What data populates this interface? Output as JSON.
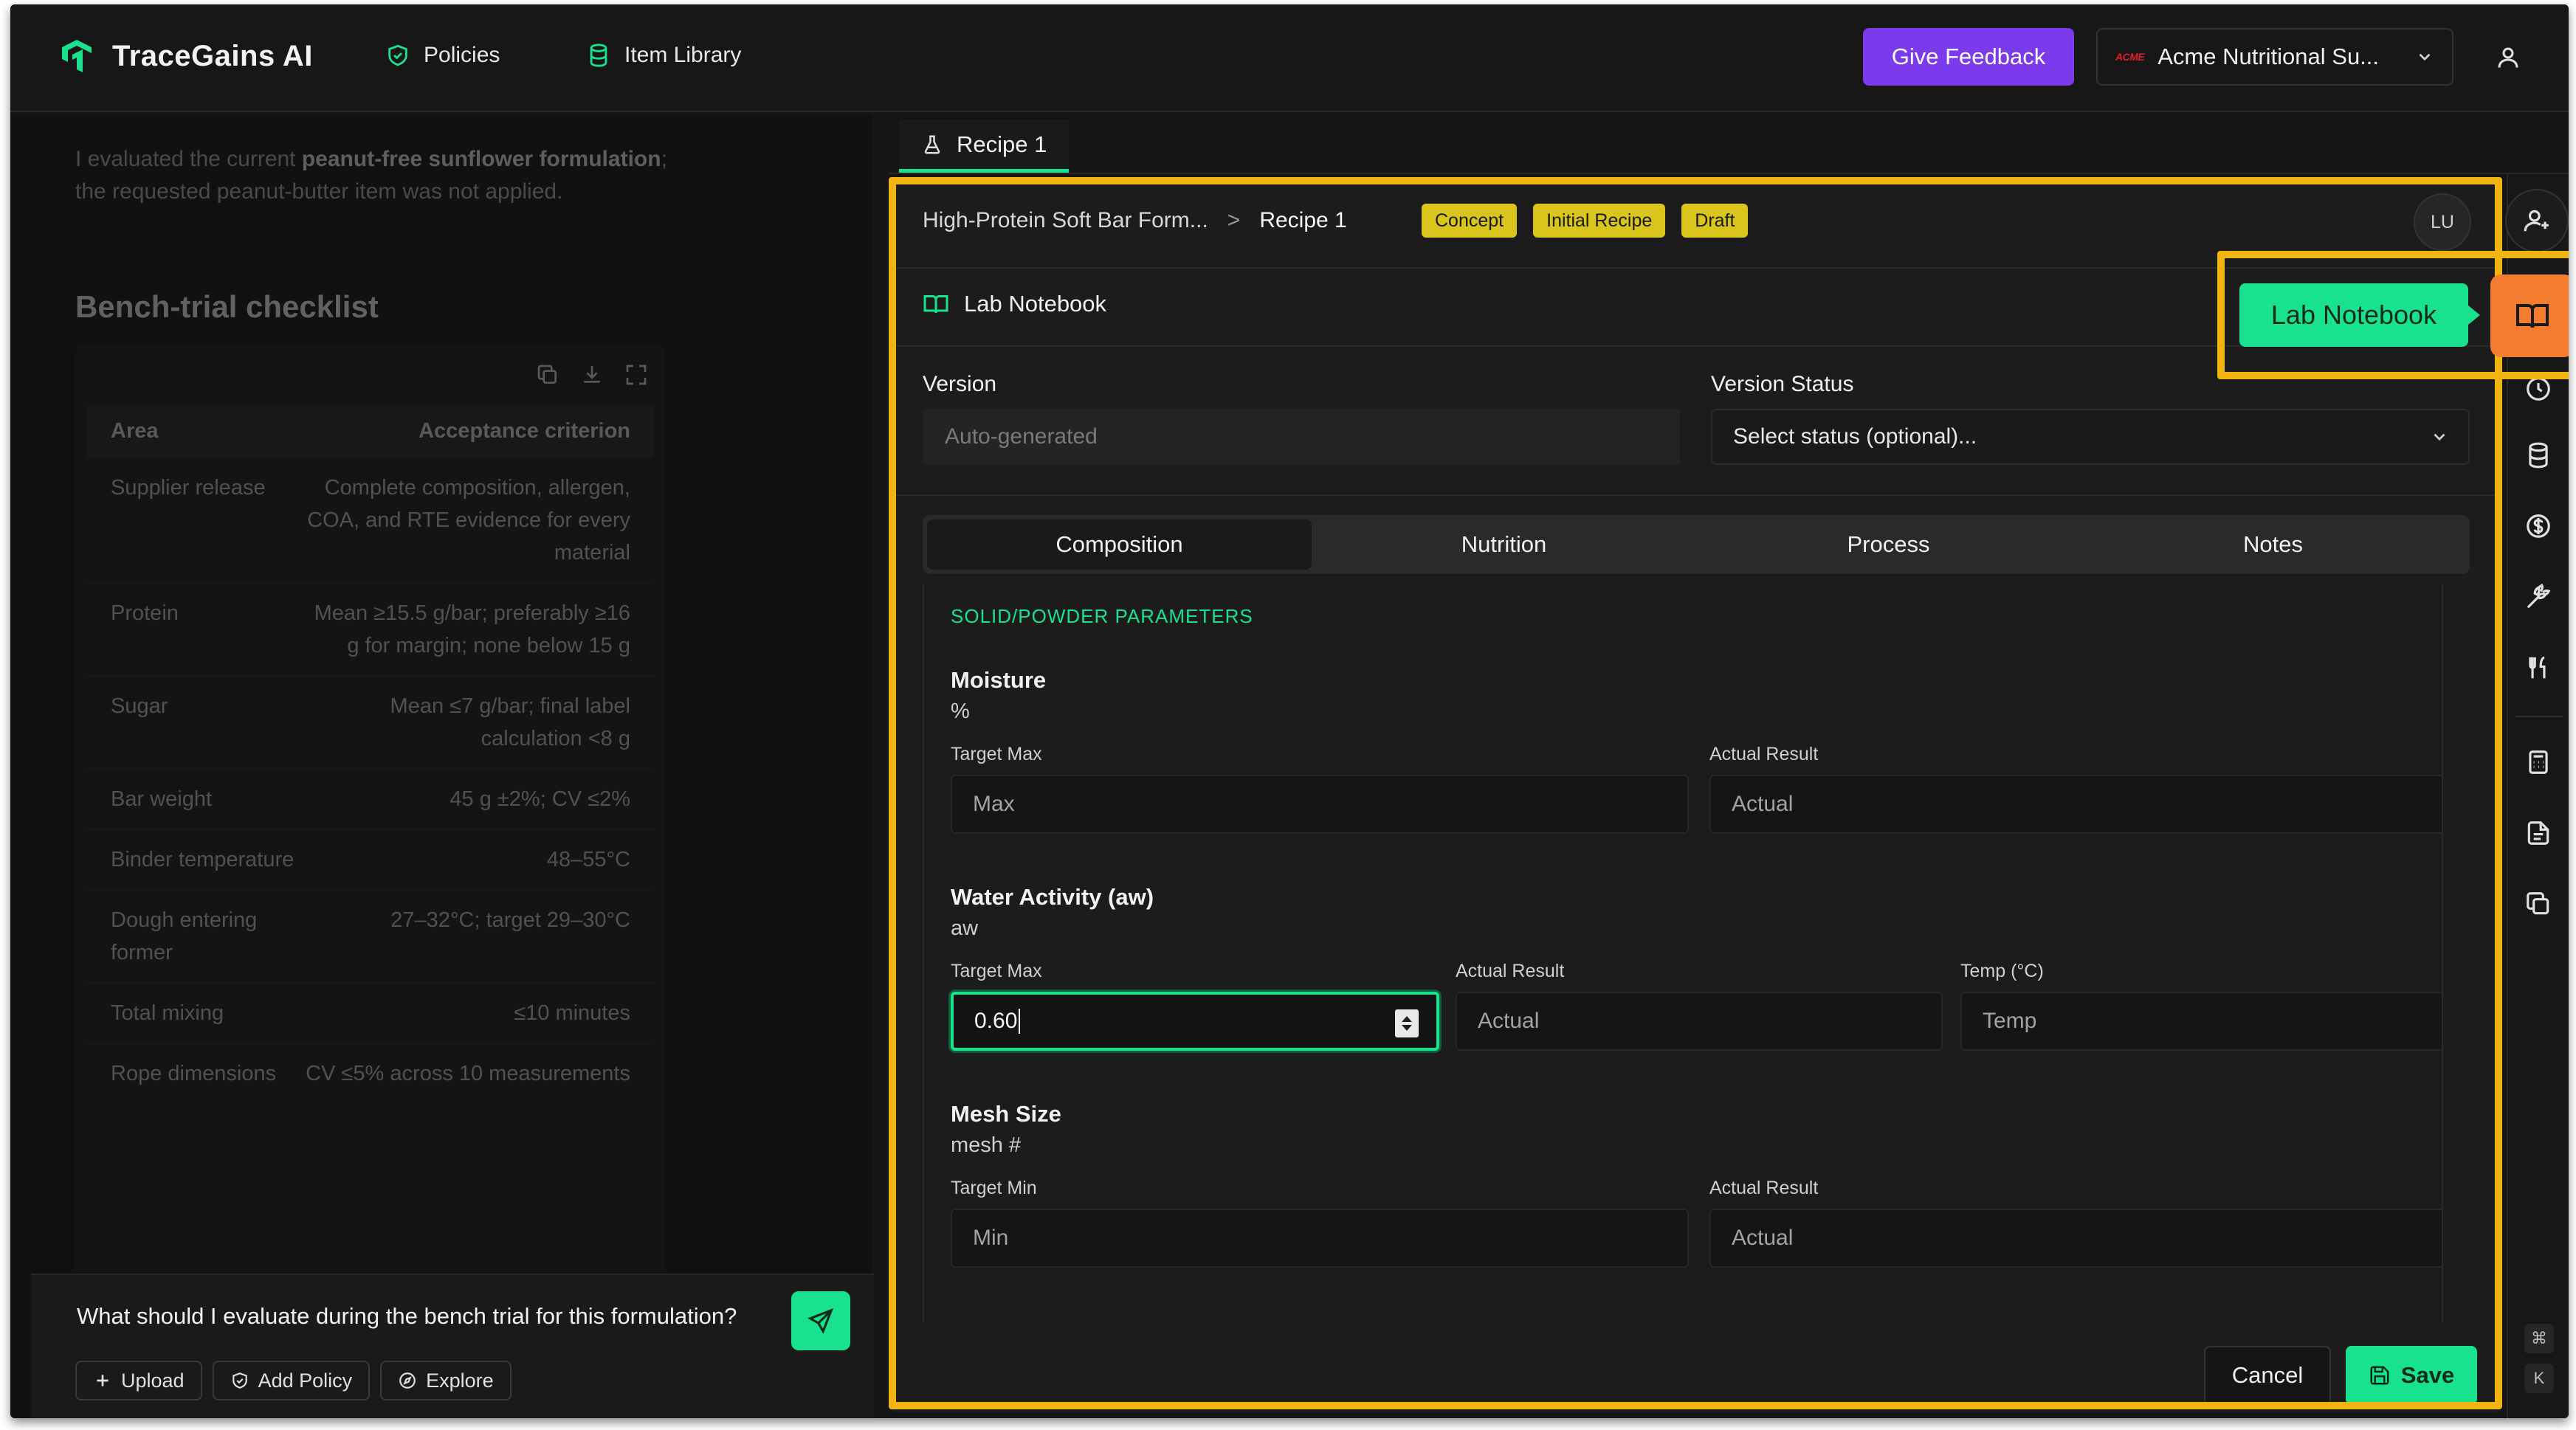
{
  "app": {
    "name": "TraceGains AI"
  },
  "nav": {
    "policies": "Policies",
    "item_library": "Item Library"
  },
  "header": {
    "feedback_label": "Give Feedback",
    "org_logo_text": "ACME",
    "org_name": "Acme Nutritional Su...",
    "accent_color": "#7c3aed"
  },
  "chat": {
    "intro_prefix": "I evaluated the current ",
    "intro_bold": "peanut-free sunflower formulation",
    "intro_suffix": "; the requested peanut-butter item was not applied.",
    "heading": "Bench-trial checklist",
    "table": {
      "headers": [
        "Area",
        "Acceptance criterion"
      ],
      "rows": [
        [
          "Supplier release",
          "Complete composition, allergen, COA, and RTE evidence for every material"
        ],
        [
          "Protein",
          "Mean ≥15.5 g/bar; preferably ≥16 g for margin; none below 15 g"
        ],
        [
          "Sugar",
          "Mean ≤7 g/bar; final label calculation <8 g"
        ],
        [
          "Bar weight",
          "45 g ±2%; CV ≤2%"
        ],
        [
          "Binder temperature",
          "48–55°C"
        ],
        [
          "Dough entering former",
          "27–32°C; target 29–30°C"
        ],
        [
          "Total mixing",
          "≤10 minutes"
        ],
        [
          "Rope dimensions",
          "CV ≤5% across 10 measurements"
        ]
      ]
    },
    "composer_text": "What should I evaluate during the bench trial for this formulation?",
    "chips": {
      "upload": "Upload",
      "add_policy": "Add Policy",
      "explore": "Explore"
    }
  },
  "tab": {
    "label": "Recipe 1"
  },
  "breadcrumb": {
    "parent": "High-Protein Soft Bar Form...",
    "separator": ">",
    "current": "Recipe 1"
  },
  "badges": [
    "Concept",
    "Initial Recipe",
    "Draft"
  ],
  "avatar_initials": "LU",
  "lab_notebook": {
    "title": "Lab Notebook",
    "tooltip": "Lab Notebook"
  },
  "version": {
    "label": "Version",
    "placeholder": "Auto-generated",
    "status_label": "Version Status",
    "status_placeholder": "Select status (optional)..."
  },
  "segments": [
    "Composition",
    "Nutrition",
    "Process",
    "Notes"
  ],
  "active_segment": "Composition",
  "composition": {
    "section_title": "SOLID/POWDER PARAMETERS",
    "moisture": {
      "name": "Moisture",
      "unit": "%",
      "target_label": "Target Max",
      "target_placeholder": "Max",
      "actual_label": "Actual Result",
      "actual_placeholder": "Actual"
    },
    "water_activity": {
      "name": "Water Activity (aw)",
      "unit": "aw",
      "target_label": "Target Max",
      "target_value": "0.60",
      "actual_label": "Actual Result",
      "actual_placeholder": "Actual",
      "temp_label": "Temp (°C)",
      "temp_placeholder": "Temp"
    },
    "mesh_size": {
      "name": "Mesh Size",
      "unit": "mesh #",
      "target_label": "Target Min",
      "target_placeholder": "Min",
      "actual_label": "Actual Result",
      "actual_placeholder": "Actual"
    }
  },
  "footer": {
    "cancel": "Cancel",
    "save": "Save"
  },
  "rail": {
    "kbd_cmd": "⌘",
    "kbd_k": "K"
  },
  "colors": {
    "brand_green": "#19e28f",
    "highlight": "#f2b50f",
    "badge_yellow": "#d9c51b",
    "notebook_orange": "#f47c2f"
  }
}
